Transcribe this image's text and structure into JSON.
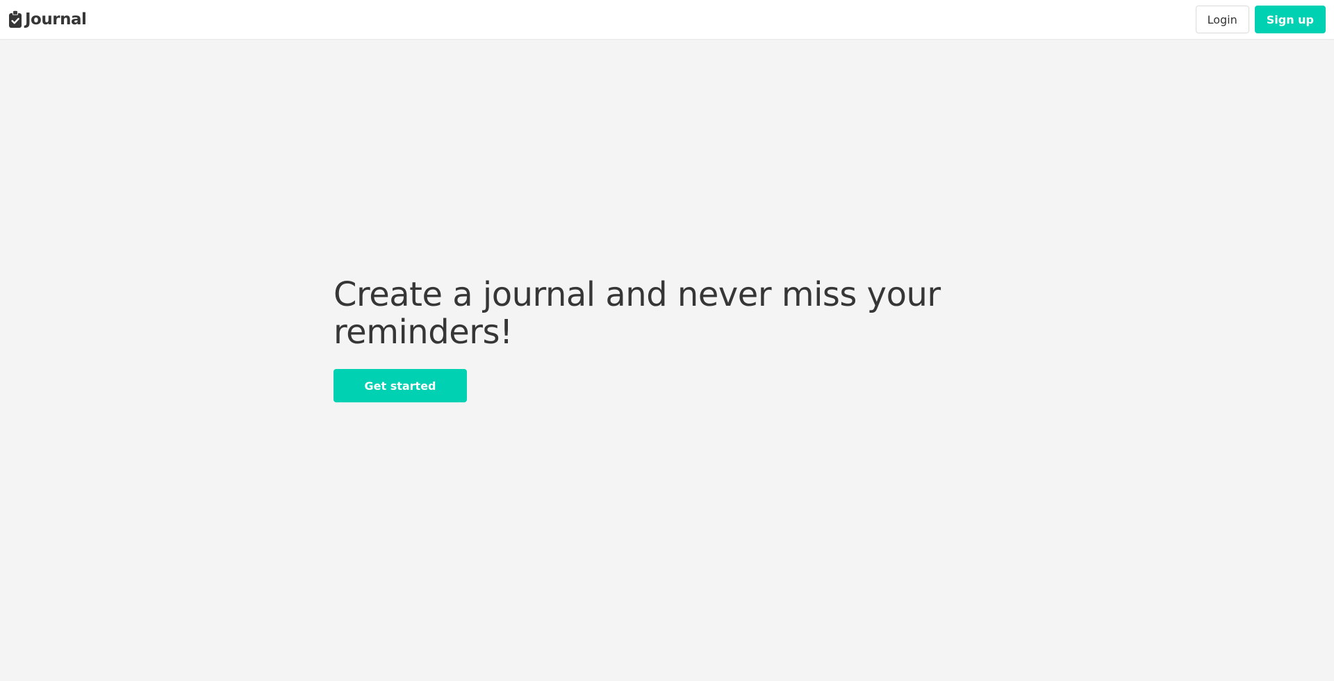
{
  "navbar": {
    "brand": {
      "icon": "clipboard-check-icon",
      "title": "Journal"
    },
    "login_label": "Login",
    "signup_label": "Sign up"
  },
  "hero": {
    "title": "Create a journal and never miss your reminders!",
    "cta_label": "Get started"
  },
  "colors": {
    "accent": "#00d1b2",
    "text": "#363636",
    "background": "#f4f4f4",
    "navbar_background": "#ffffff"
  }
}
